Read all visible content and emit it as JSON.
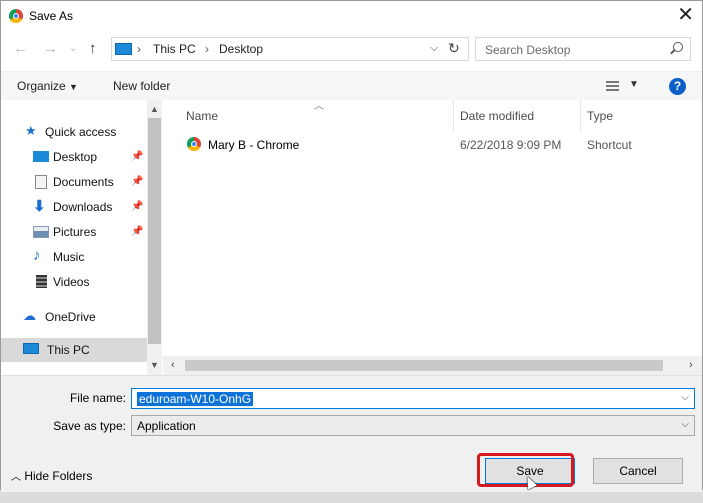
{
  "window": {
    "title": "Save As",
    "icon": "chrome-icon"
  },
  "nav": {
    "crumbs": [
      "This PC",
      "Desktop"
    ],
    "search_placeholder": "Search Desktop"
  },
  "toolbar": {
    "organize": "Organize",
    "new_folder": "New folder"
  },
  "sidebar": {
    "quick_access": "Quick access",
    "items": [
      {
        "label": "Desktop",
        "pinned": true,
        "icon": "desktop-folder-icon"
      },
      {
        "label": "Documents",
        "pinned": true,
        "icon": "documents-folder-icon"
      },
      {
        "label": "Downloads",
        "pinned": true,
        "icon": "downloads-folder-icon"
      },
      {
        "label": "Pictures",
        "pinned": true,
        "icon": "pictures-folder-icon"
      },
      {
        "label": "Music",
        "pinned": false,
        "icon": "music-folder-icon"
      },
      {
        "label": "Videos",
        "pinned": false,
        "icon": "videos-folder-icon"
      }
    ],
    "onedrive": "OneDrive",
    "this_pc": "This PC"
  },
  "files": {
    "columns": [
      "Name",
      "Date modified",
      "Type"
    ],
    "rows": [
      {
        "name": "Mary B - Chrome",
        "date": "6/22/2018 9:09 PM",
        "type": "Shortcut"
      }
    ]
  },
  "form": {
    "file_name_label": "File name:",
    "file_name_value": "eduroam-W10-OnhG",
    "save_type_label": "Save as type:",
    "save_type_value": "Application"
  },
  "footer": {
    "hide_folders": "Hide Folders",
    "save": "Save",
    "cancel": "Cancel"
  },
  "colors": {
    "accent": "#0078d7",
    "highlight_box": "#d6181f",
    "selection": "#0e73d8"
  }
}
